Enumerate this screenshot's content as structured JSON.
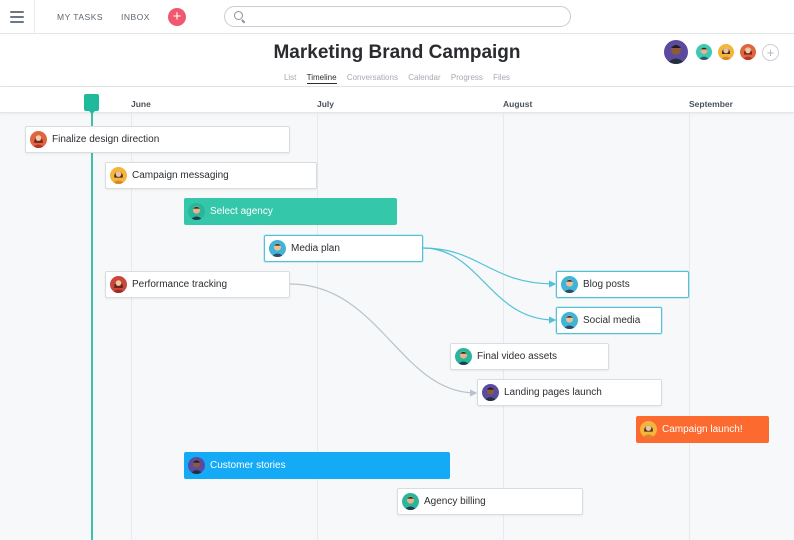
{
  "topbar": {
    "menu_icon": "hamburger-menu-icon",
    "my_tasks": "MY TASKS",
    "inbox": "INBOX",
    "add_icon": "plus-icon",
    "add_label": "+",
    "search_icon": "search-icon",
    "search_value": "",
    "search_placeholder": ""
  },
  "project": {
    "title": "Marketing Brand Campaign",
    "tabs": [
      {
        "label": "List",
        "active": false
      },
      {
        "label": "Timeline",
        "active": true
      },
      {
        "label": "Conversations",
        "active": false
      },
      {
        "label": "Calendar",
        "active": false
      },
      {
        "label": "Progress",
        "active": false
      },
      {
        "label": "Files",
        "active": false
      }
    ],
    "add_member_label": "+"
  },
  "timeline": {
    "months": [
      "June",
      "July",
      "August",
      "September"
    ],
    "tasks": [
      {
        "label": "Finalize design direction",
        "style": "default"
      },
      {
        "label": "Campaign messaging",
        "style": "default"
      },
      {
        "label": "Select agency",
        "style": "filled",
        "color": "#34c7a9"
      },
      {
        "label": "Media plan",
        "style": "selected"
      },
      {
        "label": "Performance tracking",
        "style": "default"
      },
      {
        "label": "Blog posts",
        "style": "selected"
      },
      {
        "label": "Social media",
        "style": "selected"
      },
      {
        "label": "Final video assets",
        "style": "default"
      },
      {
        "label": "Landing pages launch",
        "style": "default"
      },
      {
        "label": "Campaign launch!",
        "style": "filled",
        "color": "#fc6a2f"
      },
      {
        "label": "Customer stories",
        "style": "filled",
        "color": "#14aaf5"
      },
      {
        "label": "Agency billing",
        "style": "default"
      }
    ]
  },
  "colors": {
    "accent_pink": "#f0586f",
    "today_marker": "#1fb99c",
    "dependency_selected": "#54c1d8",
    "dependency_default": "#b9c2cb"
  }
}
